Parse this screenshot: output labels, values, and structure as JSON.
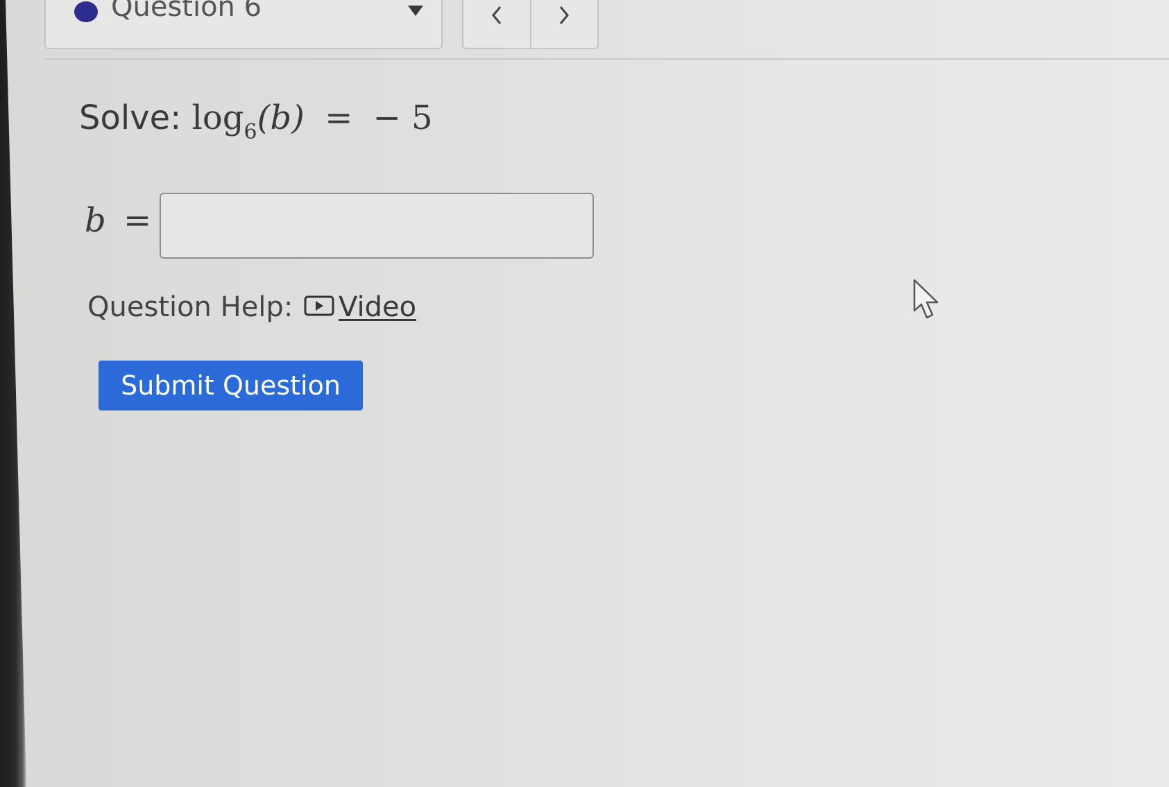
{
  "question_selector": {
    "label": "Question 6",
    "status_color": "#2c2d8c"
  },
  "navigation": {
    "prev_icon": "chevron-left-icon",
    "next_icon": "chevron-right-icon"
  },
  "problem": {
    "prefix": "Solve:",
    "log_text": "log",
    "log_base": "6",
    "argument": "(b)",
    "equals": "=",
    "rhs": "− 5"
  },
  "answer": {
    "variable": "b",
    "equals": "=",
    "value": "",
    "placeholder": ""
  },
  "help": {
    "label": "Question Help:",
    "video_label": "Video",
    "video_icon": "play-video-icon"
  },
  "submit": {
    "label": "Submit Question",
    "color": "#2a6bd9"
  }
}
